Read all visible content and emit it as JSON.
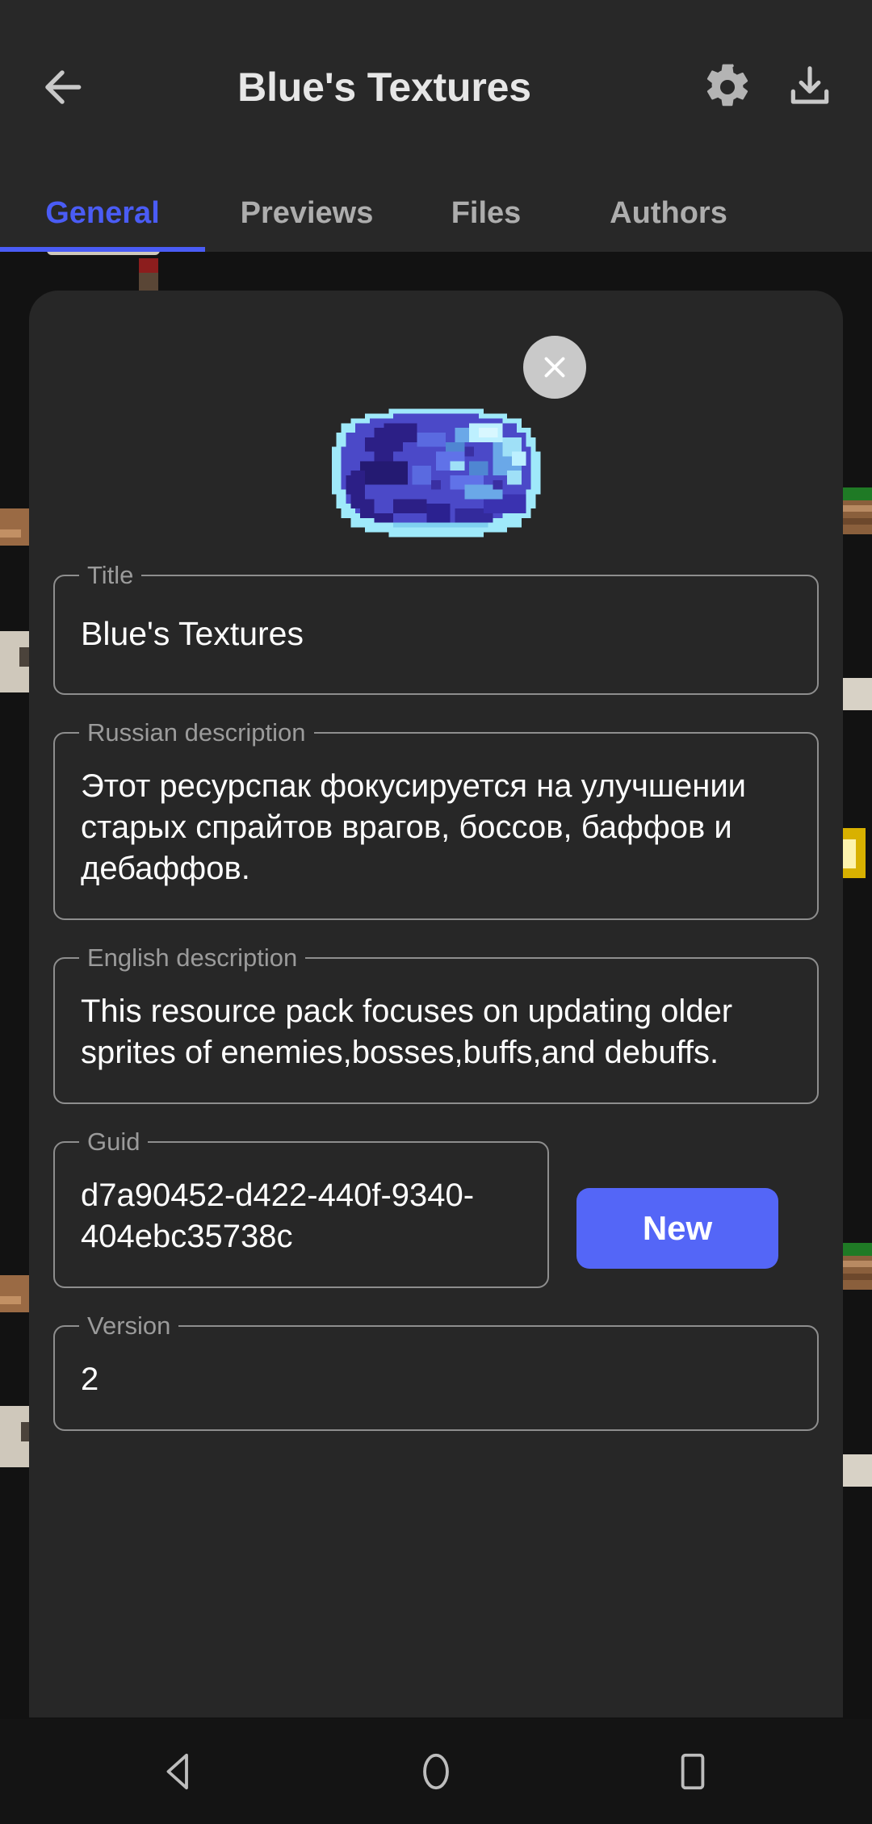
{
  "appbar": {
    "back_icon": "arrow-left-icon",
    "title": "Blue's Textures",
    "settings_icon": "gear-icon",
    "download_icon": "download-icon"
  },
  "tabs": {
    "items": [
      {
        "label": "General",
        "active": true
      },
      {
        "label": "Previews",
        "active": false
      },
      {
        "label": "Files",
        "active": false
      },
      {
        "label": "Authors",
        "active": false
      }
    ],
    "active_color": "#4a5cf5",
    "inactive_color": "#adadad"
  },
  "dialog": {
    "close_icon": "close-icon",
    "icon_name": "blue-slime-sprite",
    "fields": [
      {
        "legend": "Title",
        "value": "Blue's Textures"
      },
      {
        "legend": "Russian description",
        "value": "Этот ресурспак фокусируется на улучшении старых спрайтов врагов, боссов, баффов и дебаффов."
      },
      {
        "legend": "English description",
        "value": "This resource pack focuses on updating older sprites of enemies,bosses,buffs,and debuffs."
      },
      {
        "legend": "Guid",
        "value": "d7a90452-d422-440f-9340-404ebc35738c"
      },
      {
        "legend": "Version",
        "value": "2"
      }
    ],
    "new_button": {
      "label": "New",
      "color": "#5466f7"
    }
  },
  "navbar": {
    "back_icon": "nav-back-triangle-icon",
    "home_icon": "nav-home-circle-icon",
    "recents_icon": "nav-recents-square-icon"
  },
  "theme": {
    "appbar_bg": "#282828",
    "dialog_bg": "#272727",
    "page_bg": "#121212",
    "text_primary": "#ffffff",
    "text_secondary": "#9b9b9b",
    "accent": "#4a5cf5"
  }
}
